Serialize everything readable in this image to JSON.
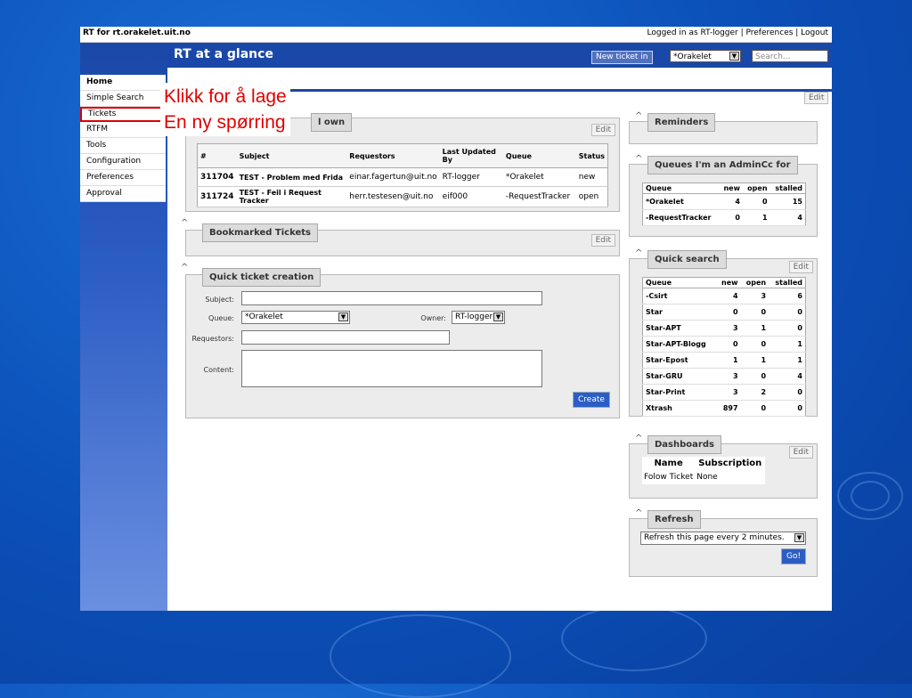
{
  "topbar": {
    "app_title": "RT for rt.orakelet.uit.no",
    "links": "Logged in as RT-logger | Preferences | Logout"
  },
  "header": {
    "title": "RT at a glance",
    "new_ticket_label": "New ticket in",
    "queue_select": "*Orakelet",
    "search_placeholder": "Search..."
  },
  "sidebar": {
    "items": [
      {
        "label": "Home"
      },
      {
        "label": "Simple Search"
      },
      {
        "label": "Tickets"
      },
      {
        "label": "RTFM"
      },
      {
        "label": "Tools"
      },
      {
        "label": "Configuration"
      },
      {
        "label": "Preferences"
      },
      {
        "label": "Approval"
      }
    ]
  },
  "annotation": {
    "line1": "Klikk for å lage",
    "line2": "En ny spørring"
  },
  "edit_label": "Edit",
  "tickets_panel": {
    "title_visible": "l own",
    "columns": [
      "#",
      "Subject",
      "Requestors",
      "Last Updated By",
      "Queue",
      "Status"
    ],
    "rows": [
      {
        "id": "311704",
        "subject": "TEST - Problem med Frida",
        "requestors": "einar.fagertun@uit.no",
        "updated_by": "RT-logger",
        "queue": "*Orakelet",
        "status": "new"
      },
      {
        "id": "311724",
        "subject": "TEST - Feil i Request Tracker",
        "requestors": "herr.testesen@uit.no",
        "updated_by": "eif000",
        "queue": "-RequestTracker",
        "status": "open"
      }
    ]
  },
  "bookmarked": {
    "title": "Bookmarked Tickets"
  },
  "quick_create": {
    "title": "Quick ticket creation",
    "subject_label": "Subject:",
    "queue_label": "Queue:",
    "queue_value": "*Orakelet",
    "owner_label": "Owner:",
    "owner_value": "RT-logger",
    "requestors_label": "Requestors:",
    "content_label": "Content:",
    "create_button": "Create"
  },
  "reminders": {
    "title": "Reminders"
  },
  "admincc": {
    "title": "Queues I'm an AdminCc for",
    "columns": [
      "Queue",
      "new",
      "open",
      "stalled"
    ],
    "rows": [
      {
        "queue": "*Orakelet",
        "new": "4",
        "open": "0",
        "stalled": "15"
      },
      {
        "queue": "-RequestTracker",
        "new": "0",
        "open": "1",
        "stalled": "4"
      }
    ]
  },
  "quick_search": {
    "title": "Quick search",
    "columns": [
      "Queue",
      "new",
      "open",
      "stalled"
    ],
    "rows": [
      {
        "queue": "-Csirt",
        "new": "4",
        "open": "3",
        "stalled": "6"
      },
      {
        "queue": "Star",
        "new": "0",
        "open": "0",
        "stalled": "0"
      },
      {
        "queue": "Star-APT",
        "new": "3",
        "open": "1",
        "stalled": "0"
      },
      {
        "queue": "Star-APT-Blogg",
        "new": "0",
        "open": "0",
        "stalled": "1"
      },
      {
        "queue": "Star-Epost",
        "new": "1",
        "open": "1",
        "stalled": "1"
      },
      {
        "queue": "Star-GRU",
        "new": "3",
        "open": "0",
        "stalled": "4"
      },
      {
        "queue": "Star-Print",
        "new": "3",
        "open": "2",
        "stalled": "0"
      },
      {
        "queue": "Xtrash",
        "new": "897",
        "open": "0",
        "stalled": "0"
      }
    ]
  },
  "dashboards": {
    "title": "Dashboards",
    "col_name": "Name",
    "col_subscription": "Subscription",
    "row_name": "Folow Ticket",
    "row_subscription": "None"
  },
  "refresh": {
    "title": "Refresh",
    "select_value": "Refresh this page every 2 minutes.",
    "go_button": "Go!"
  }
}
